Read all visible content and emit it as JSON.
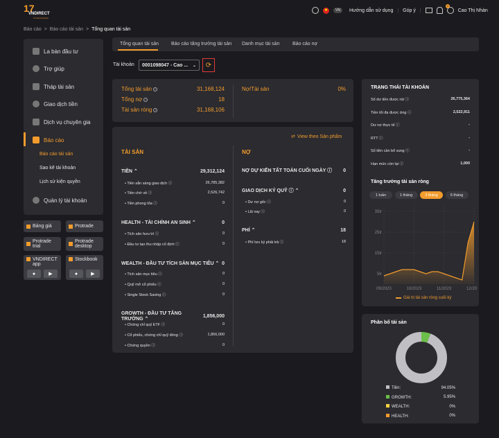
{
  "header": {
    "lang": "VN",
    "guide": "Hướng dẫn sử dụng",
    "feedback": "Góp ý",
    "user": "Cao Thị Nhàn",
    "notif_count": "1"
  },
  "logo": {
    "brand": "VNDIRECT",
    "sub": "Vì một tương lai"
  },
  "breadcrumb": {
    "b1": "Báo cáo",
    "b2": "Báo cáo tài sản",
    "b3": "Tổng quan tài sản",
    "sep": ">"
  },
  "sidebar": {
    "items": [
      "La bàn đầu tư",
      "Trợ giúp",
      "Tháp tài sản",
      "Giao dịch tiền",
      "Dịch vụ chuyên gia",
      "Báo cáo",
      "Quản lý tài khoản"
    ],
    "sub": [
      "Báo cáo tài sản",
      "Sao kê tài khoản",
      "Lịch sử kiện quyền"
    ],
    "apps": [
      "Bảng giá",
      "Protrade",
      "Protrade trial",
      "Protrade desktop",
      "VNDIRECT app",
      "Stockbook"
    ]
  },
  "tabs": [
    "Tổng quan tài sản",
    "Báo cáo tăng trưởng tài sản",
    "Danh mục tài sản",
    "Báo cáo nợ"
  ],
  "account": {
    "label": "Tài khoản",
    "value": "0001098047 - Cao ..."
  },
  "summary": {
    "total_label": "Tổng tài sản",
    "total": "31,168,124",
    "debt_label": "Tổng nợ",
    "debt": "18",
    "net_label": "Tài sản ròng",
    "net": "31,168,106",
    "ratio_label": "Nợ/Tài sản",
    "ratio": "0%"
  },
  "view_product": "View theo Sản phẩm",
  "assets": {
    "title": "TÀI SẢN",
    "groups": [
      {
        "name": "TIỀN",
        "value": "29,312,124",
        "rows": [
          [
            "Tiền sẵn sàng giao dịch",
            "26,785,382"
          ],
          [
            "Tiền chờ về",
            "2,526,742"
          ],
          [
            "Tiền phong tỏa",
            "0"
          ]
        ]
      },
      {
        "name": "HEALTH - TÀI CHÍNH AN SINH",
        "value": "0",
        "rows": [
          [
            "Tích sản hưu trí",
            "0"
          ],
          [
            "Đầu tư tạo thu nhập cố định",
            "0"
          ]
        ]
      },
      {
        "name": "WEALTH - ĐẦU TƯ TÍCH SẢN MỤC TIÊU",
        "value": "0",
        "rows": [
          [
            "Tích sản mục tiêu",
            "0"
          ],
          [
            "Quỹ mở cổ phiếu",
            "0"
          ],
          [
            "Single Stock Saving",
            "0"
          ]
        ]
      },
      {
        "name": "GROWTH - ĐẦU TƯ TĂNG TRƯỞNG",
        "value": "1,856,000",
        "rows": [
          [
            "Chứng chỉ quỹ ETF",
            "0"
          ],
          [
            "Cổ phiếu, chứng chỉ quỹ đóng",
            "1,856,000"
          ],
          [
            "Chứng quyền",
            "0"
          ]
        ]
      }
    ]
  },
  "debt": {
    "title": "NỢ",
    "groups": [
      {
        "name": "NỢ DỰ KIẾN TẤT TOÁN CUỐI NGÀY",
        "value": "0",
        "rows": []
      },
      {
        "name": "GIAO DỊCH KÝ QUỸ",
        "value": "0",
        "rows": [
          [
            "Dư nợ gốc",
            "0"
          ],
          [
            "Lãi vay",
            "0"
          ]
        ]
      },
      {
        "name": "PHÍ",
        "value": "18",
        "rows": [
          [
            "Phí lưu ký phải trả",
            "18"
          ]
        ]
      }
    ]
  },
  "status": {
    "title": "TRẠNG THÁI TÀI KHOẢN",
    "rows": [
      [
        "Số dư tiền được rút",
        "26,775,364"
      ],
      [
        "Tiền tối đa được ứng",
        "2,522,911"
      ],
      [
        "Dư nợ thực tế",
        "-"
      ],
      [
        "RTT",
        "-"
      ],
      [
        "Số tiền cần bổ sung",
        "-"
      ],
      [
        "Hạn mức còn lại",
        "1,000"
      ]
    ]
  },
  "growth": {
    "title": "Tăng trưởng tài sản ròng",
    "periods": [
      "1 tuần",
      "1 tháng",
      "3 tháng",
      "6 tháng"
    ],
    "active": 2,
    "legend": "Giá trị tài sản ròng cuối kỳ"
  },
  "chart_data": [
    {
      "type": "area",
      "title": "Tăng trưởng tài sản ròng",
      "x": [
        "09/2023",
        "10/2023",
        "11/2023",
        "12/2023"
      ],
      "yticks": [
        "35tr",
        "25tr",
        "15tr",
        "5tr"
      ],
      "series": [
        {
          "name": "Giá trị tài sản ròng cuối kỳ",
          "values": [
            4,
            5,
            6,
            7,
            7,
            7,
            6,
            5,
            6,
            6,
            5,
            4,
            3,
            2,
            20,
            30
          ]
        }
      ],
      "color": "#f39c2d"
    },
    {
      "type": "pie",
      "title": "Phân bổ tài sản",
      "categories": [
        "Tiền:",
        "GROWTH:",
        "WEALTH:",
        "HEALTH:"
      ],
      "values": [
        94.05,
        5.95,
        0,
        0
      ],
      "labels": [
        "94.05%",
        "5.95%",
        "0%",
        "0%"
      ],
      "colors": [
        "#bfbfc4",
        "#6cc04a",
        "#f5d142",
        "#f39c2d"
      ]
    }
  ],
  "alloc_title": "Phân bổ tài sản"
}
